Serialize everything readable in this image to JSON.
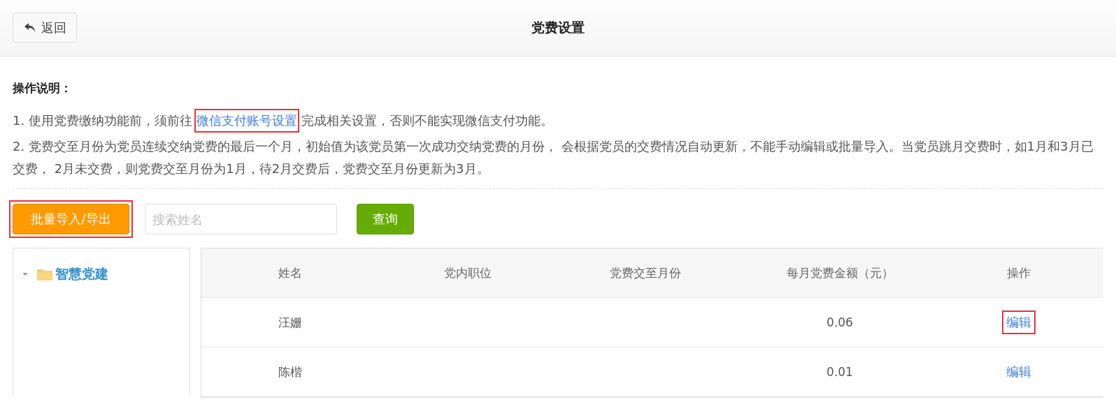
{
  "header": {
    "back_button": {
      "label": "返回"
    },
    "title": "党费设置"
  },
  "instructions": {
    "heading": "操作说明：",
    "notes": [
      {
        "kind": "link",
        "before": "1. 使用党费缴纳功能前，须前往",
        "link": {
          "label": "微信支付账号设置",
          "highlighted": true
        },
        "after": "完成相关设置，否则不能实现微信支付功能。"
      },
      {
        "kind": "plain",
        "text": "2. 党费交至月份为党员连续交纳党费的最后一个月，初始值为该党员第一次成功交纳党费的月份， 会根据党员的交费情况自动更新，不能手动编辑或批量导入。当党员跳月交费时，如1月和3月已交费， 2月未交费，则党费交至月份为1月，待2月交费后，党费交至月份更新为3月。"
      }
    ]
  },
  "toolbar": {
    "import_button": {
      "label": "批量导入/导出",
      "highlighted": true
    },
    "search": {
      "placeholder": "搜索姓名"
    },
    "query_button": {
      "label": "查询"
    }
  },
  "tree": {
    "items": [
      {
        "label": "智慧党建",
        "expanded": true
      }
    ]
  },
  "table": {
    "columns": [
      "姓名",
      "党内职位",
      "党费交至月份",
      "每月党费金额（元）",
      "操作"
    ],
    "rows": [
      {
        "name": "汪姗",
        "position": "",
        "paid_until": "",
        "amount": "0.06",
        "action": {
          "label": "编辑",
          "highlighted": true
        }
      },
      {
        "name": "陈楷",
        "position": "",
        "paid_until": "",
        "amount": "0.01",
        "action": {
          "label": "编辑",
          "highlighted": false
        }
      }
    ]
  }
}
